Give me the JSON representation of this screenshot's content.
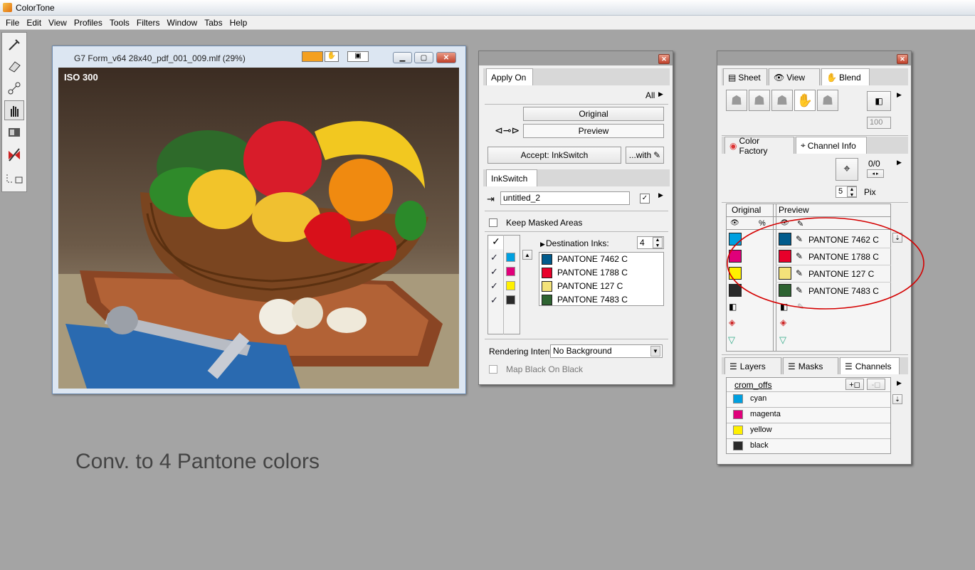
{
  "app": {
    "title": "ColorTone"
  },
  "menu": [
    "File",
    "Edit",
    "View",
    "Profiles",
    "Tools",
    "Filters",
    "Window",
    "Tabs",
    "Help"
  ],
  "image_window": {
    "title": "G7 Form_v64 28x40_pdf_001_009.mlf (29%)",
    "overlay_label": "ISO 300"
  },
  "apply_panel": {
    "tab_apply": "Apply On",
    "all_label": "All",
    "original_label": "Original",
    "preview_label": "Preview",
    "accept_label": "Accept: InkSwitch",
    "with_label": "...with",
    "tab_inkswitch": "InkSwitch",
    "setup_name": "untitled_2",
    "keep_masked_label": "Keep Masked Areas",
    "destination_inks_label": "Destination Inks:",
    "destination_inks_count": "4",
    "source_colors": [
      {
        "color": "#00a0e0"
      },
      {
        "color": "#e0007a"
      },
      {
        "color": "#fff000"
      },
      {
        "color": "#2a2a2a"
      }
    ],
    "inks": [
      {
        "name": "PANTONE 7462 C",
        "color": "#005b8c"
      },
      {
        "name": "PANTONE 1788 C",
        "color": "#e8002a"
      },
      {
        "name": "PANTONE 127 C",
        "color": "#f3e27a"
      },
      {
        "name": "PANTONE 7483 C",
        "color": "#2e6331"
      }
    ],
    "rendering_intent_label": "Rendering Intent",
    "rendering_intent_value": "No Background",
    "map_black_label": "Map Black On Black"
  },
  "right_panel": {
    "tabs_top": [
      "Sheet",
      "View",
      "Blend"
    ],
    "blend_value": "100",
    "tabs_mid": [
      "Color Factory",
      "Channel Info"
    ],
    "channel_ratio": "0/0",
    "pix_value": "5",
    "pix_label": "Pix",
    "col_original": "Original",
    "col_percent": "%",
    "col_preview": "Preview",
    "original_colors": [
      "#00a0e0",
      "#e0007a",
      "#fff000",
      "#2a2a2a"
    ],
    "preview_inks": [
      {
        "name": "PANTONE 7462 C",
        "color": "#005b8c"
      },
      {
        "name": "PANTONE 1788 C",
        "color": "#e8002a"
      },
      {
        "name": "PANTONE 127 C",
        "color": "#f3e27a"
      },
      {
        "name": "PANTONE 7483 C",
        "color": "#2e6331"
      }
    ],
    "tabs_bottom": [
      "Layers",
      "Masks",
      "Channels"
    ],
    "channel_group": "crom_offs",
    "channels": [
      {
        "name": "cyan",
        "color": "#00a0e0"
      },
      {
        "name": "magenta",
        "color": "#e0007a"
      },
      {
        "name": "yellow",
        "color": "#fff000"
      },
      {
        "name": "black",
        "color": "#2a2a2a"
      }
    ],
    "annotation_color": "#d40000"
  },
  "caption": "Conv. to 4 Pantone colors"
}
